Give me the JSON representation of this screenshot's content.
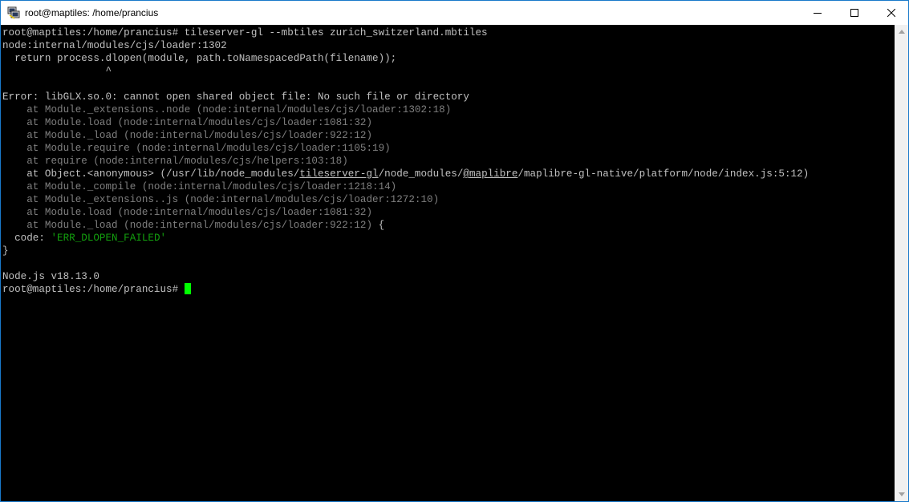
{
  "window": {
    "title": "root@maptiles: /home/prancius"
  },
  "terminal": {
    "lines": [
      "root@maptiles:/home/prancius# tileserver-gl --mbtiles zurich_switzerland.mbtiles",
      "node:internal/modules/cjs/loader:1302",
      "  return process.dlopen(module, path.toNamespacedPath(filename));",
      "                 ^",
      "",
      "Error: libGLX.so.0: cannot open shared object file: No such file or directory",
      "    at Module._extensions..node (node:internal/modules/cjs/loader:1302:18)",
      "    at Module.load (node:internal/modules/cjs/loader:1081:32)",
      "    at Module._load (node:internal/modules/cjs/loader:922:12)",
      "    at Module.require (node:internal/modules/cjs/loader:1105:19)",
      "    at require (node:internal/modules/cjs/helpers:103:18)",
      "",
      "    at Module._compile (node:internal/modules/cjs/loader:1218:14)",
      "    at Module._extensions..js (node:internal/modules/cjs/loader:1272:10)",
      "    at Module.load (node:internal/modules/cjs/loader:1081:32)",
      "    at Module._load (node:internal/modules/cjs/loader:922:12)",
      "",
      "",
      "}",
      "",
      "",
      "Node.js v18.13.0"
    ],
    "object_line": {
      "prefix": "    at Object.<anonymous> (/usr/lib/node_modules/",
      "link1": "tileserver-gl",
      "middle": "/node_modules/",
      "link2": "@maplibre",
      "suffix": "/maplibre-gl-native/platform/node/index.js:5:12)"
    },
    "brace_after_load": " {",
    "code_line": {
      "key": "  code: ",
      "value": "'ERR_DLOPEN_FAILED'"
    },
    "prompt": "root@maptiles:/home/prancius# "
  },
  "colors": {
    "text": "#c0c0c0",
    "dim": "#7f7f7f",
    "string": "#13a10e",
    "cursor": "#00ff00",
    "border": "#1979ca"
  }
}
